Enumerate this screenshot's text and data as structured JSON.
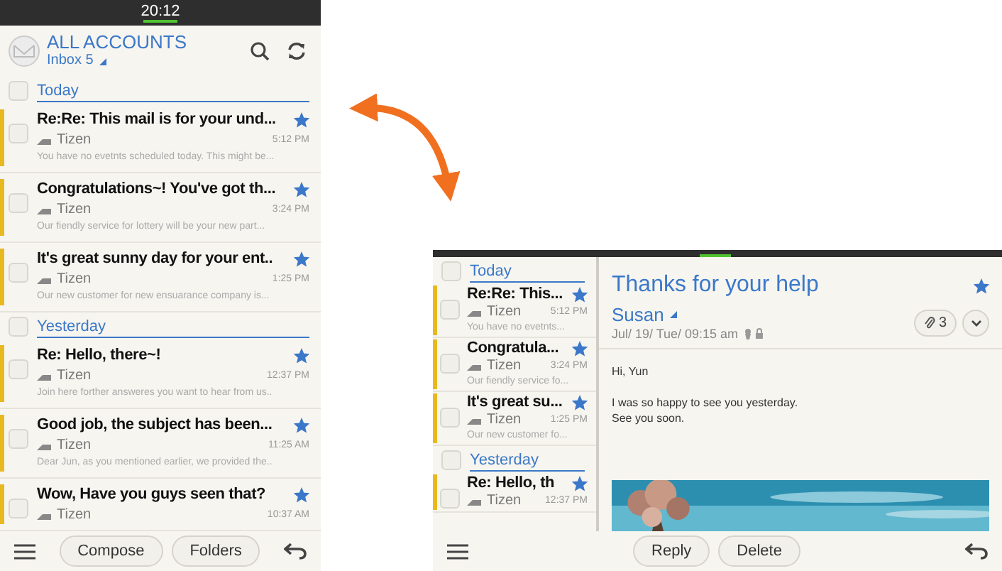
{
  "phone": {
    "status_bar": {
      "time": "20:12"
    },
    "header": {
      "title": "ALL ACCOUNTS",
      "subtitle": "Inbox 5"
    },
    "sections": [
      {
        "title": "Today",
        "checked": false,
        "mails": [
          {
            "subject": "Re:Re: This mail is for your und...",
            "sender": "Tizen",
            "time": "5:12 PM",
            "preview": "You have no evetnts scheduled today. This might be...",
            "starred": true,
            "unread": true,
            "checked": false
          },
          {
            "subject": "Congratulations~! You've got th...",
            "sender": "Tizen",
            "time": "3:24 PM",
            "preview": "Our fiendly service for lottery will be your new part...",
            "starred": true,
            "unread": true,
            "checked": false
          },
          {
            "subject": "It's great sunny day for your ent..",
            "sender": "Tizen",
            "time": "1:25 PM",
            "preview": "Our new customer for new ensuarance company is...",
            "starred": true,
            "unread": true,
            "checked": false
          }
        ]
      },
      {
        "title": "Yesterday",
        "checked": false,
        "mails": [
          {
            "subject": "Re: Hello, there~!",
            "sender": "Tizen",
            "time": "12:37 PM",
            "preview": "Join here forther answeres you want to hear from us..",
            "starred": true,
            "unread": true,
            "checked": false
          },
          {
            "subject": "Good job, the subject has been...",
            "sender": "Tizen",
            "time": "11:25 AM",
            "preview": "Dear Jun, as you mentioned earlier, we provided the..",
            "starred": true,
            "unread": true,
            "checked": false
          },
          {
            "subject": "Wow, Have you guys seen that?",
            "sender": "Tizen",
            "time": "10:37 AM",
            "starred": true,
            "unread": true,
            "checked": false
          }
        ]
      }
    ],
    "toolbar": {
      "buttons": [
        "Compose",
        "Folders"
      ]
    }
  },
  "tablet": {
    "list": {
      "sections": [
        {
          "title": "Today",
          "checked": false,
          "mails": [
            {
              "subject": "Re:Re: This...",
              "sender": "Tizen",
              "time": "5:12 PM",
              "preview": "You have no evetnts...",
              "starred": true,
              "unread": true,
              "checked": false
            },
            {
              "subject": "Congratula...",
              "sender": "Tizen",
              "time": "3:24 PM",
              "preview": "Our fiendly service fo...",
              "starred": true,
              "unread": true,
              "checked": false
            },
            {
              "subject": "It's great su...",
              "sender": "Tizen",
              "time": "1:25 PM",
              "preview": "Our new customer fo...",
              "starred": true,
              "unread": true,
              "checked": false
            }
          ]
        },
        {
          "title": "Yesterday",
          "checked": false,
          "mails": [
            {
              "subject": "Re: Hello, th",
              "sender": "Tizen",
              "time": "12:37 PM",
              "starred": true,
              "unread": true,
              "checked": false
            }
          ]
        }
      ]
    },
    "detail": {
      "subject": "Thanks for your help",
      "starred": true,
      "sender": "Susan",
      "date": "Jul/ 19/ Tue/ 09:15 am",
      "attachments": "3",
      "body": [
        "Hi, Yun",
        "I was so happy to see you yesterday.\nSee you soon."
      ],
      "image": {
        "kind": "picture"
      }
    },
    "toolbar": {
      "buttons": [
        "Reply",
        "Delete"
      ]
    }
  }
}
